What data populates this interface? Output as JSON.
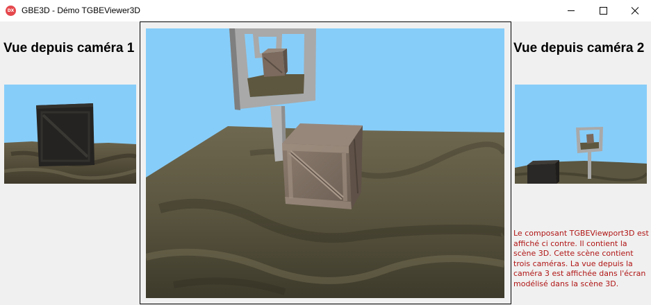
{
  "window": {
    "title": "GBE3D - Démo TGBEViewer3D",
    "icon_text": "DX",
    "icon": "app-logo-icon",
    "controls": [
      "minimize-icon",
      "maximize-icon",
      "close-icon"
    ]
  },
  "views": {
    "left_title": "Vue depuis caméra 1",
    "right_title": "Vue depuis caméra 2"
  },
  "info": {
    "text": "Le composant TGBEViewport3D est affiché ci contre. Il contient la scène 3D.  Cette scène contient trois caméras. La vue depuis la caméra 3 est affichée dans l'écran modélisé dans la scène 3D."
  },
  "colors": {
    "sky": "#87cdf9",
    "terrain": "#5b5640",
    "crate": "#7d6c5f",
    "screen_frame": "#a6a6a6",
    "info_text": "#b01515"
  }
}
